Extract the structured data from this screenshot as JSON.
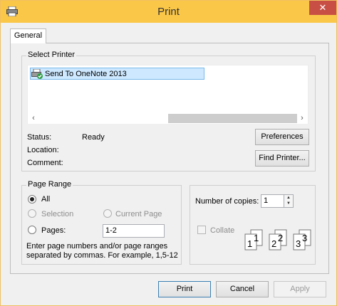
{
  "window": {
    "title": "Print",
    "close_glyph": "✕"
  },
  "tabs": [
    {
      "label": "General"
    }
  ],
  "select_printer": {
    "legend": "Select Printer",
    "printers": [
      {
        "name": "Send To OneNote 2013",
        "selected": true
      }
    ],
    "scroll_left": "‹",
    "scroll_right": "›"
  },
  "status": {
    "status_label": "Status:",
    "status_value": "Ready",
    "location_label": "Location:",
    "location_value": "",
    "comment_label": "Comment:",
    "comment_value": ""
  },
  "buttons": {
    "preferences": "Preferences",
    "find_printer": "Find Printer...",
    "print": "Print",
    "cancel": "Cancel",
    "apply": "Apply"
  },
  "page_range": {
    "legend": "Page Range",
    "all": "All",
    "selection": "Selection",
    "current_page": "Current Page",
    "pages": "Pages:",
    "pages_value": "1-2",
    "hint_line1": "Enter page numbers and/or page ranges",
    "hint_line2": "separated by commas.  For example, 1,5-12"
  },
  "copies": {
    "label": "Number of copies:",
    "value": "1",
    "collate": "Collate",
    "collate_checked": false
  },
  "collate_pages": [
    "1",
    "1",
    "2",
    "2",
    "3",
    "3"
  ],
  "colors": {
    "titlebar": "#fbc748",
    "close": "#c74f44",
    "selection": "#cde8ff"
  }
}
